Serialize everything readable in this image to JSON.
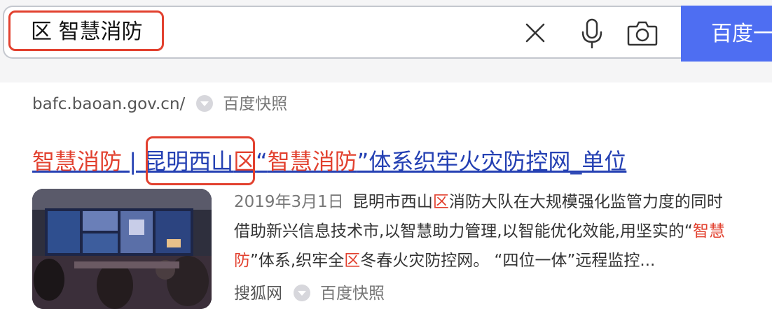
{
  "search": {
    "query": "区 智慧消防",
    "button_label": "百度一"
  },
  "prev_result": {
    "url": "bafc.baoan.gov.cn/",
    "snapshot_label": "百度快照"
  },
  "result": {
    "title_part1": "智慧消防",
    "title_separator": " | ",
    "title_part2": "昆明西山",
    "title_part3": "区",
    "title_part4": "“",
    "title_part5": "智慧消防",
    "title_part6": "”体系织牢火灾防控网_单位",
    "date": "2019年3月1日",
    "snippet_l1_a": "昆明市西山",
    "snippet_l1_b": "区",
    "snippet_l1_c": "消防大队在大规模强化监管力度的同时",
    "snippet_l2_a": "借助新兴信息技术市,以智慧助力管理,以智能优化效能,用坚实的“",
    "snippet_l2_b": "智慧",
    "snippet_l3_a": "防",
    "snippet_l3_b": "”体系,织牢全",
    "snippet_l3_c": "区",
    "snippet_l3_d": "冬春火灾防控网。 “四位一体”远程监控...",
    "site_name": "搜狐网",
    "snapshot_label": "百度快照"
  },
  "colors": {
    "highlight": "#e2412f",
    "link": "#2440b3",
    "button": "#4e6ef2"
  },
  "icons": [
    "clear-icon",
    "microphone-icon",
    "camera-icon",
    "dropdown-icon"
  ]
}
